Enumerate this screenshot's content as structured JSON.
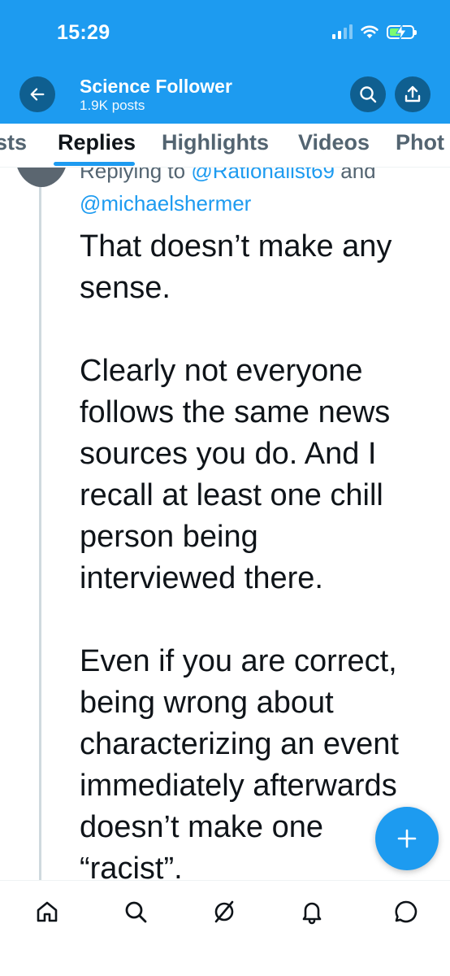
{
  "status_bar": {
    "time": "15:29"
  },
  "header": {
    "profile_name": "Science Follower",
    "posts_count": "1.9K posts"
  },
  "tabs": [
    {
      "label": "Posts",
      "visible_text": "sts",
      "active": false
    },
    {
      "label": "Replies",
      "active": true
    },
    {
      "label": "Highlights",
      "active": false
    },
    {
      "label": "Videos",
      "active": false
    },
    {
      "label": "Photos",
      "visible_text": "Phot",
      "active": false
    }
  ],
  "tweet": {
    "replying_prefix": "Replying to ",
    "replying_mention_1": "@Rationalist69",
    "replying_and": " and",
    "replying_mention_2": "@michaelshermer",
    "lines": [
      "That doesn’t make any",
      "sense.",
      "",
      "Clearly not everyone",
      "follows the same news",
      "sources you do. And I",
      "recall at least one chill",
      "person being",
      "interviewed there.",
      "",
      "Even if you are correct,",
      "being wrong about",
      "characterizing an event",
      "immediately afterwards",
      "doesn’t make one",
      "“racist”."
    ]
  },
  "icons": {
    "back": "arrow-left-icon",
    "search": "search-icon",
    "share": "share-icon",
    "compose": "plus-icon",
    "nav": [
      "home-icon",
      "search-icon",
      "grok-icon",
      "notifications-icon",
      "messages-icon"
    ]
  },
  "colors": {
    "brand_blue": "#1d9bf0",
    "header_button": "#0f5f90",
    "text_primary": "#0f1419",
    "text_secondary": "#536471",
    "thread_line": "#cfd9de",
    "battery_fill": "#7cfc72"
  }
}
